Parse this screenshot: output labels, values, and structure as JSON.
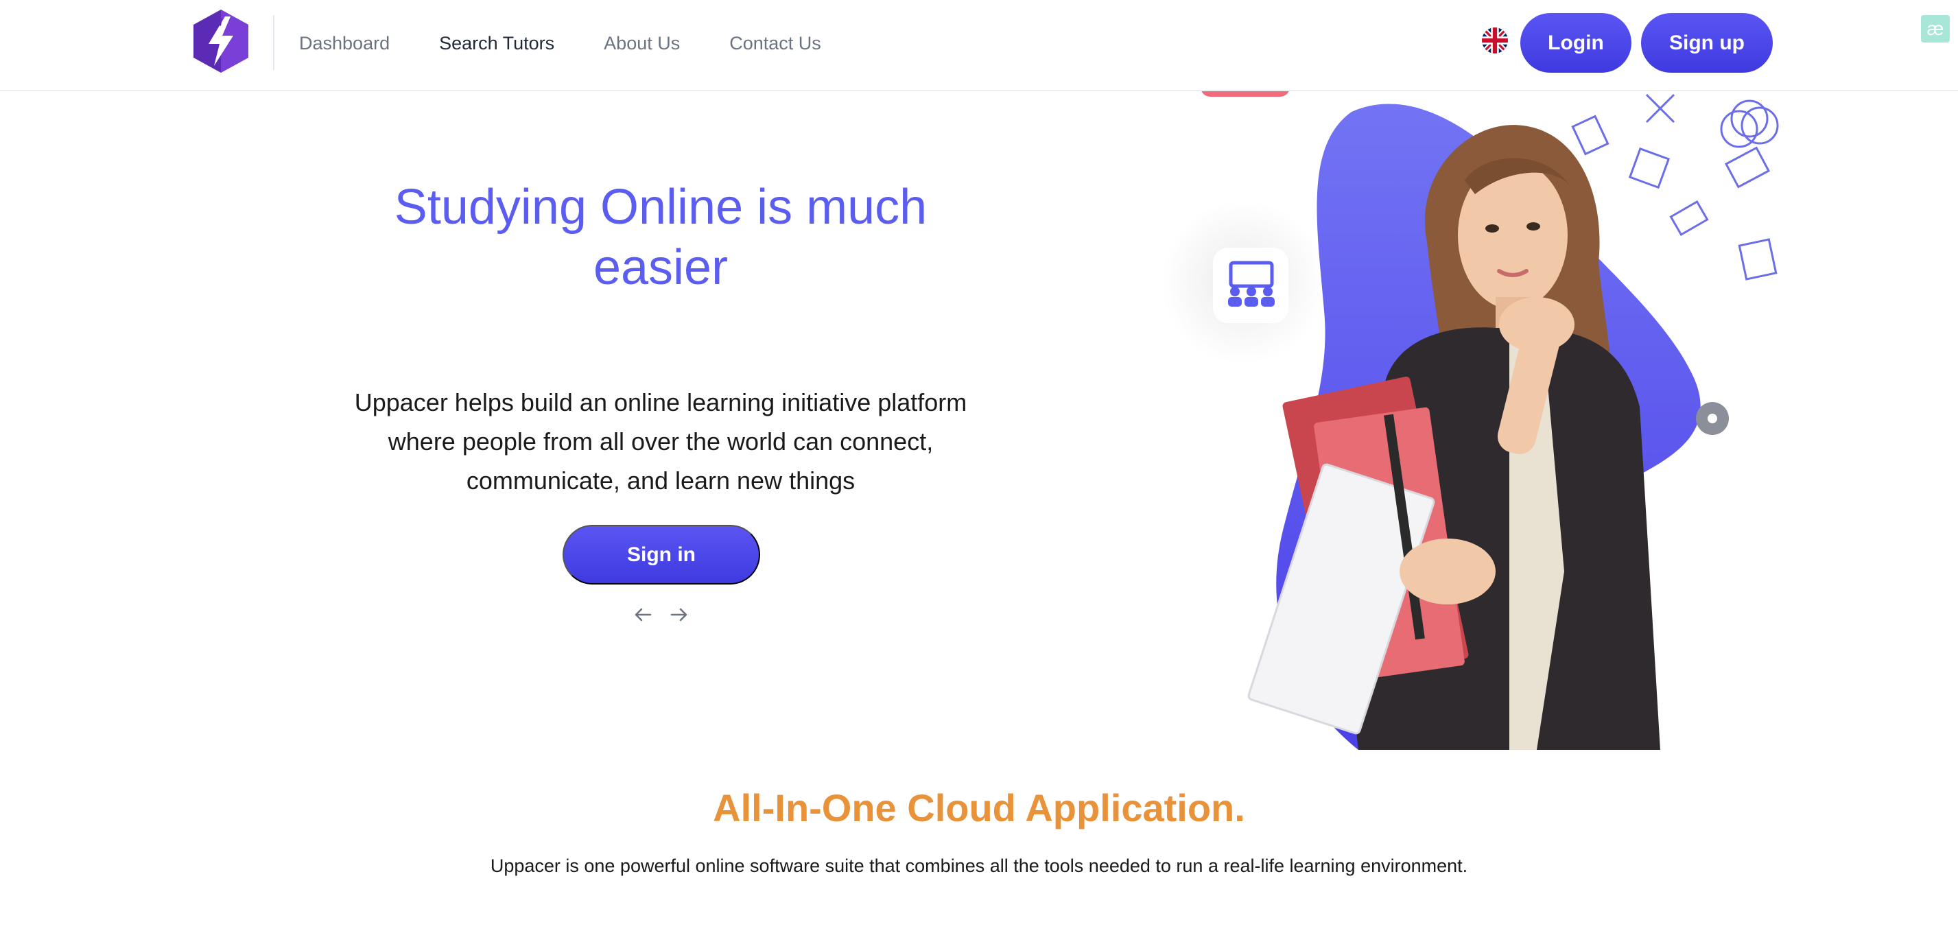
{
  "header": {
    "nav": [
      {
        "label": "Dashboard"
      },
      {
        "label": "Search Tutors"
      },
      {
        "label": "About Us"
      },
      {
        "label": "Contact Us"
      }
    ],
    "login_label": "Login",
    "signup_label": "Sign up",
    "badge": "æ"
  },
  "hero": {
    "title": "Studying Online is much easier",
    "text": "Uppacer helps build an online learning initiative platform where people from all over the world can connect, communicate, and learn new things",
    "signin_label": "Sign in",
    "prev_icon": "arrow-left-icon",
    "next_icon": "arrow-right-icon"
  },
  "section": {
    "title": "All-In-One Cloud Application.",
    "text": "Uppacer is one powerful online software suite that combines all the tools needed to run a real-life learning environment."
  },
  "colors": {
    "accent": "#5b5cf0",
    "button": "#4a45ea",
    "section_title": "#e8923a"
  }
}
